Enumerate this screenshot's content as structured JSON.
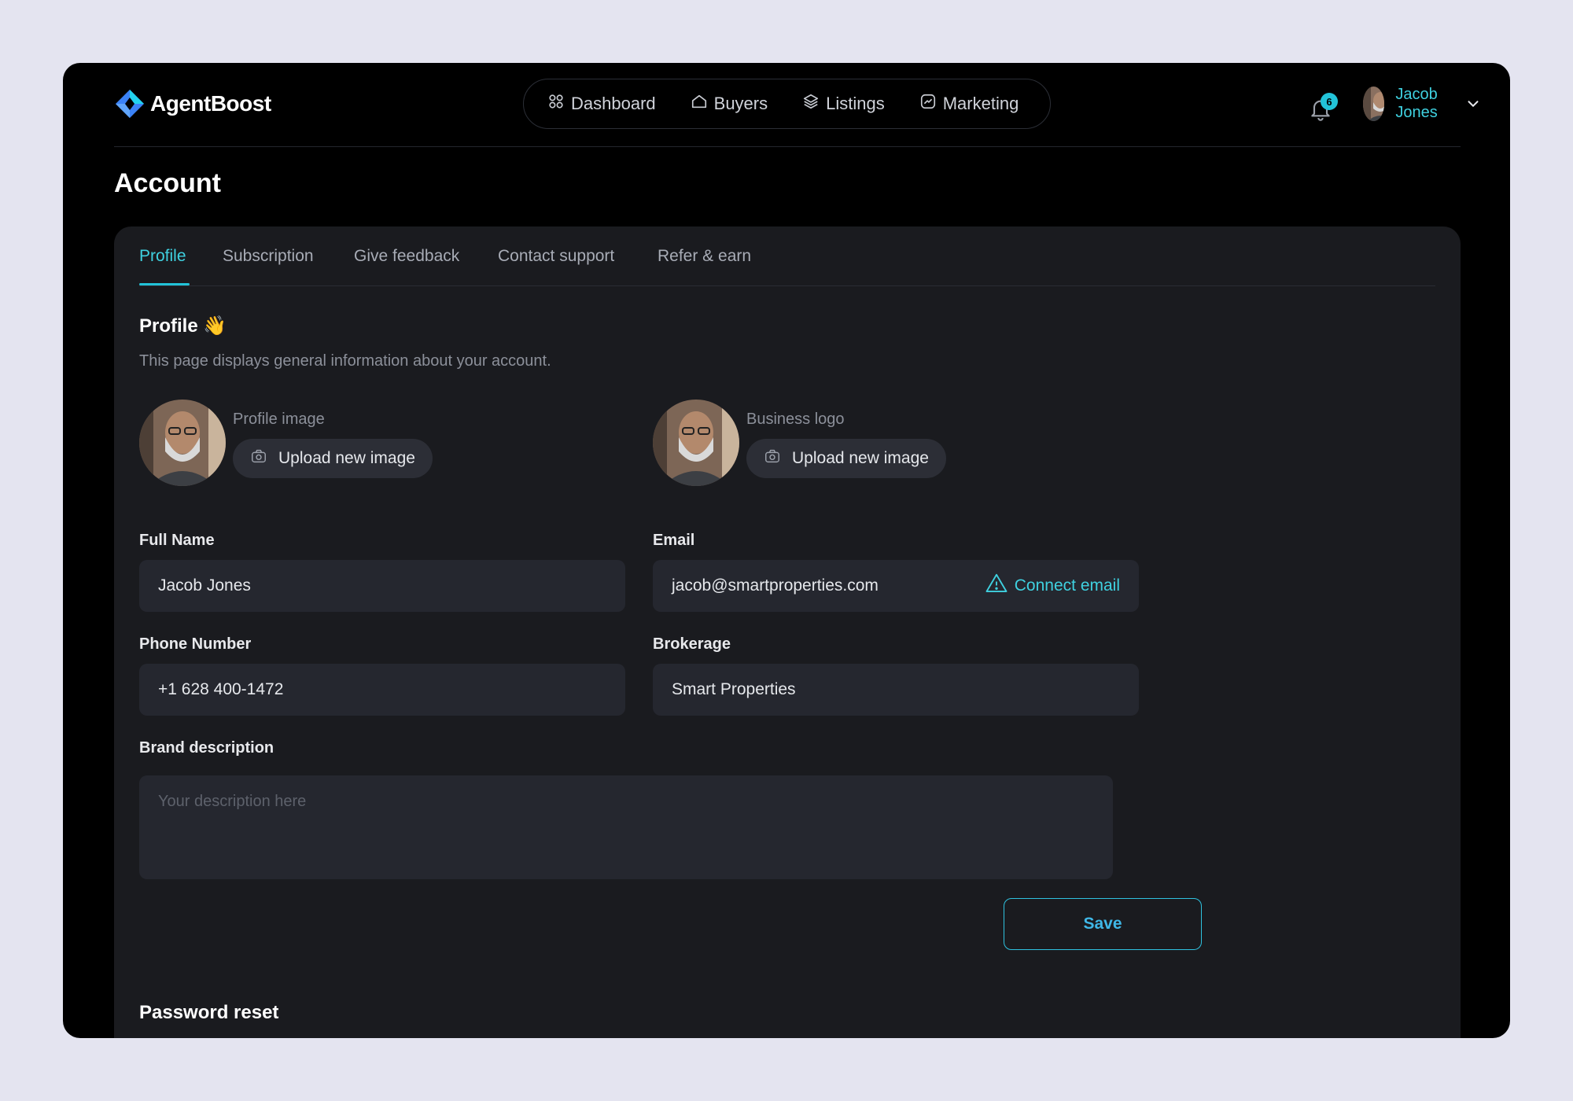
{
  "brand": {
    "name": "AgentBoost"
  },
  "nav": [
    {
      "label": "Dashboard",
      "icon": "dashboard-grid-icon"
    },
    {
      "label": "Buyers",
      "icon": "home-icon"
    },
    {
      "label": "Listings",
      "icon": "layers-icon"
    },
    {
      "label": "Marketing",
      "icon": "chart-icon"
    }
  ],
  "notifications": {
    "count": "6"
  },
  "user": {
    "name": "Jacob Jones"
  },
  "page": {
    "title": "Account"
  },
  "tabs": [
    {
      "label": "Profile",
      "active": true
    },
    {
      "label": "Subscription"
    },
    {
      "label": "Give feedback"
    },
    {
      "label": "Contact support"
    },
    {
      "label": "Refer & earn"
    }
  ],
  "profile": {
    "title": "Profile 👋",
    "subtitle": "This page displays general information about your account.",
    "profile_image_label": "Profile image",
    "business_logo_label": "Business logo",
    "upload_label": "Upload new image"
  },
  "form": {
    "full_name": {
      "label": "Full Name",
      "value": "Jacob Jones"
    },
    "email": {
      "label": "Email",
      "value": "jacob@smartproperties.com",
      "action": "Connect email"
    },
    "phone": {
      "label": "Phone Number",
      "value": "+1 628 400-1472"
    },
    "brokerage": {
      "label": "Brokerage",
      "value": "Smart Properties"
    },
    "brand_description": {
      "label": "Brand description",
      "placeholder": "Your description here",
      "value": ""
    },
    "save_label": "Save"
  },
  "password": {
    "title": "Password reset"
  },
  "colors": {
    "accent": "#22c3d8",
    "accent_text": "#3fd1e0",
    "panel": "#1a1b1f",
    "input": "#25272f"
  }
}
